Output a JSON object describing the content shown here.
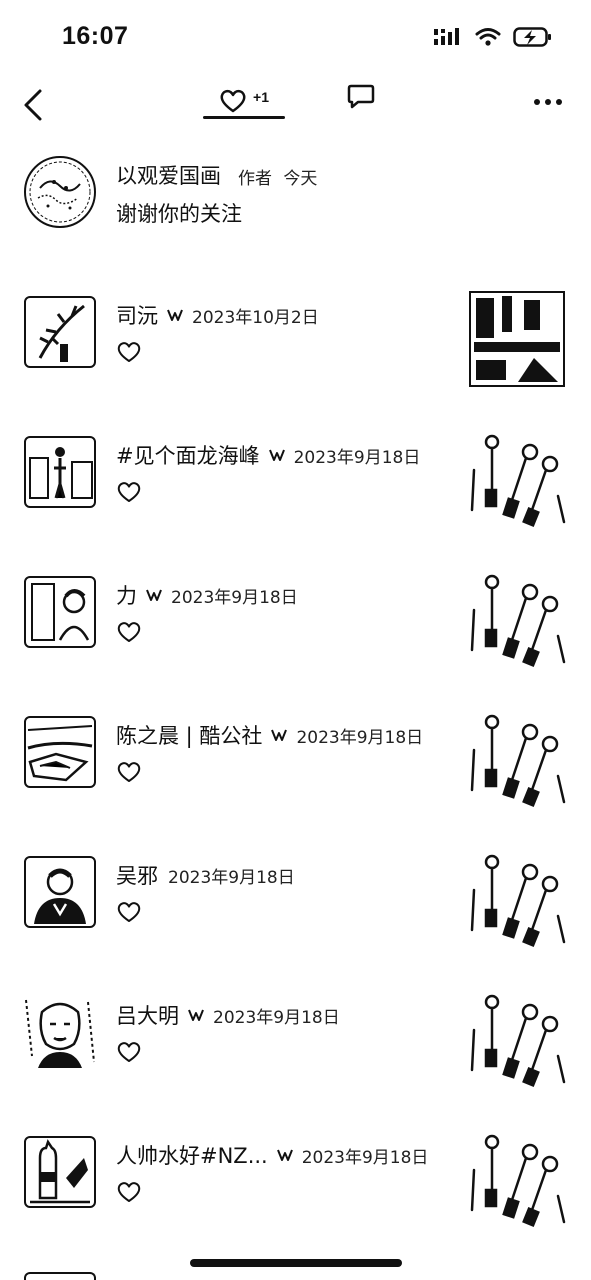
{
  "status_bar": {
    "time": "16:07"
  },
  "nav": {
    "likes_count": "+1"
  },
  "author": {
    "name": "以观爱国画",
    "role": "作者",
    "time": "今天",
    "message": "谢谢你的关注"
  },
  "likes": [
    {
      "name": "司沅",
      "verified": true,
      "date": "2023年10月2日"
    },
    {
      "name": "#见个面龙海峰",
      "verified": true,
      "date": "2023年9月18日"
    },
    {
      "name": "力",
      "verified": true,
      "date": "2023年9月18日"
    },
    {
      "name": "陈之晨 | 酷公社",
      "verified": true,
      "date": "2023年9月18日"
    },
    {
      "name": "吴邪",
      "verified": false,
      "date": "2023年9月18日"
    },
    {
      "name": "吕大明",
      "verified": true,
      "date": "2023年9月18日"
    },
    {
      "name": "人帅水好#NZ...",
      "verified": true,
      "date": "2023年9月18日"
    }
  ]
}
